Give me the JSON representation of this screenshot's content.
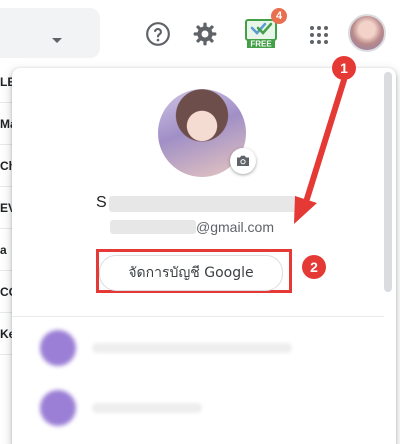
{
  "header": {
    "notification_count": "4",
    "free_label": "FREE",
    "icons": [
      "chevron-down-icon",
      "help-icon",
      "gear-icon",
      "free-addon-icon",
      "apps-icon",
      "avatar"
    ]
  },
  "left_list": {
    "rows": [
      "LE",
      "Ma",
      "Ch",
      "EV",
      "a",
      "CO",
      "Ke"
    ]
  },
  "account_menu": {
    "name_visible": "S",
    "email_suffix": "@gmail.com",
    "manage_button_label": "จัดการบัญชี Google"
  },
  "annotations": {
    "step1": "1",
    "step2": "2"
  },
  "colors": {
    "annotation": "#e53935",
    "badge": "#e8704f"
  }
}
